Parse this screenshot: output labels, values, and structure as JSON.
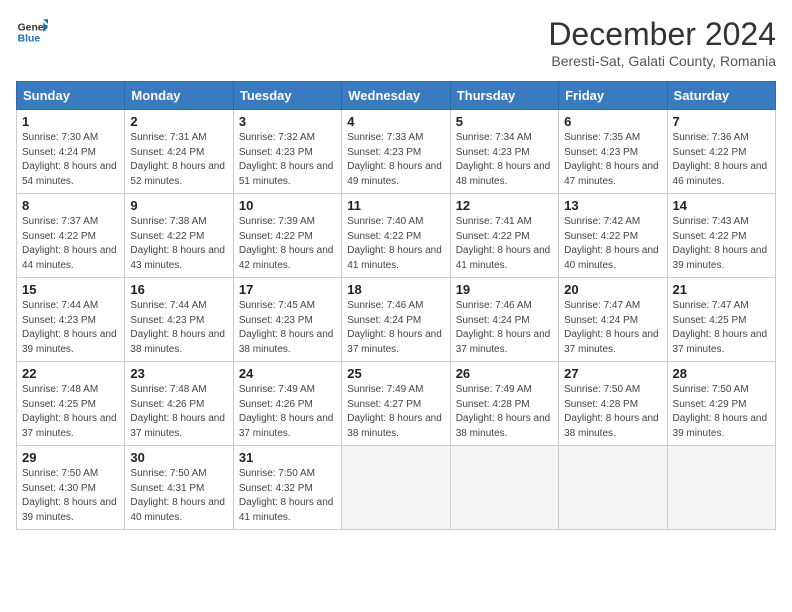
{
  "header": {
    "logo_line1": "General",
    "logo_line2": "Blue",
    "title": "December 2024",
    "subtitle": "Beresti-Sat, Galati County, Romania"
  },
  "weekdays": [
    "Sunday",
    "Monday",
    "Tuesday",
    "Wednesday",
    "Thursday",
    "Friday",
    "Saturday"
  ],
  "weeks": [
    [
      {
        "day": "1",
        "sunrise": "Sunrise: 7:30 AM",
        "sunset": "Sunset: 4:24 PM",
        "daylight": "Daylight: 8 hours and 54 minutes."
      },
      {
        "day": "2",
        "sunrise": "Sunrise: 7:31 AM",
        "sunset": "Sunset: 4:24 PM",
        "daylight": "Daylight: 8 hours and 52 minutes."
      },
      {
        "day": "3",
        "sunrise": "Sunrise: 7:32 AM",
        "sunset": "Sunset: 4:23 PM",
        "daylight": "Daylight: 8 hours and 51 minutes."
      },
      {
        "day": "4",
        "sunrise": "Sunrise: 7:33 AM",
        "sunset": "Sunset: 4:23 PM",
        "daylight": "Daylight: 8 hours and 49 minutes."
      },
      {
        "day": "5",
        "sunrise": "Sunrise: 7:34 AM",
        "sunset": "Sunset: 4:23 PM",
        "daylight": "Daylight: 8 hours and 48 minutes."
      },
      {
        "day": "6",
        "sunrise": "Sunrise: 7:35 AM",
        "sunset": "Sunset: 4:23 PM",
        "daylight": "Daylight: 8 hours and 47 minutes."
      },
      {
        "day": "7",
        "sunrise": "Sunrise: 7:36 AM",
        "sunset": "Sunset: 4:22 PM",
        "daylight": "Daylight: 8 hours and 46 minutes."
      }
    ],
    [
      {
        "day": "8",
        "sunrise": "Sunrise: 7:37 AM",
        "sunset": "Sunset: 4:22 PM",
        "daylight": "Daylight: 8 hours and 44 minutes."
      },
      {
        "day": "9",
        "sunrise": "Sunrise: 7:38 AM",
        "sunset": "Sunset: 4:22 PM",
        "daylight": "Daylight: 8 hours and 43 minutes."
      },
      {
        "day": "10",
        "sunrise": "Sunrise: 7:39 AM",
        "sunset": "Sunset: 4:22 PM",
        "daylight": "Daylight: 8 hours and 42 minutes."
      },
      {
        "day": "11",
        "sunrise": "Sunrise: 7:40 AM",
        "sunset": "Sunset: 4:22 PM",
        "daylight": "Daylight: 8 hours and 41 minutes."
      },
      {
        "day": "12",
        "sunrise": "Sunrise: 7:41 AM",
        "sunset": "Sunset: 4:22 PM",
        "daylight": "Daylight: 8 hours and 41 minutes."
      },
      {
        "day": "13",
        "sunrise": "Sunrise: 7:42 AM",
        "sunset": "Sunset: 4:22 PM",
        "daylight": "Daylight: 8 hours and 40 minutes."
      },
      {
        "day": "14",
        "sunrise": "Sunrise: 7:43 AM",
        "sunset": "Sunset: 4:22 PM",
        "daylight": "Daylight: 8 hours and 39 minutes."
      }
    ],
    [
      {
        "day": "15",
        "sunrise": "Sunrise: 7:44 AM",
        "sunset": "Sunset: 4:23 PM",
        "daylight": "Daylight: 8 hours and 39 minutes."
      },
      {
        "day": "16",
        "sunrise": "Sunrise: 7:44 AM",
        "sunset": "Sunset: 4:23 PM",
        "daylight": "Daylight: 8 hours and 38 minutes."
      },
      {
        "day": "17",
        "sunrise": "Sunrise: 7:45 AM",
        "sunset": "Sunset: 4:23 PM",
        "daylight": "Daylight: 8 hours and 38 minutes."
      },
      {
        "day": "18",
        "sunrise": "Sunrise: 7:46 AM",
        "sunset": "Sunset: 4:24 PM",
        "daylight": "Daylight: 8 hours and 37 minutes."
      },
      {
        "day": "19",
        "sunrise": "Sunrise: 7:46 AM",
        "sunset": "Sunset: 4:24 PM",
        "daylight": "Daylight: 8 hours and 37 minutes."
      },
      {
        "day": "20",
        "sunrise": "Sunrise: 7:47 AM",
        "sunset": "Sunset: 4:24 PM",
        "daylight": "Daylight: 8 hours and 37 minutes."
      },
      {
        "day": "21",
        "sunrise": "Sunrise: 7:47 AM",
        "sunset": "Sunset: 4:25 PM",
        "daylight": "Daylight: 8 hours and 37 minutes."
      }
    ],
    [
      {
        "day": "22",
        "sunrise": "Sunrise: 7:48 AM",
        "sunset": "Sunset: 4:25 PM",
        "daylight": "Daylight: 8 hours and 37 minutes."
      },
      {
        "day": "23",
        "sunrise": "Sunrise: 7:48 AM",
        "sunset": "Sunset: 4:26 PM",
        "daylight": "Daylight: 8 hours and 37 minutes."
      },
      {
        "day": "24",
        "sunrise": "Sunrise: 7:49 AM",
        "sunset": "Sunset: 4:26 PM",
        "daylight": "Daylight: 8 hours and 37 minutes."
      },
      {
        "day": "25",
        "sunrise": "Sunrise: 7:49 AM",
        "sunset": "Sunset: 4:27 PM",
        "daylight": "Daylight: 8 hours and 38 minutes."
      },
      {
        "day": "26",
        "sunrise": "Sunrise: 7:49 AM",
        "sunset": "Sunset: 4:28 PM",
        "daylight": "Daylight: 8 hours and 38 minutes."
      },
      {
        "day": "27",
        "sunrise": "Sunrise: 7:50 AM",
        "sunset": "Sunset: 4:28 PM",
        "daylight": "Daylight: 8 hours and 38 minutes."
      },
      {
        "day": "28",
        "sunrise": "Sunrise: 7:50 AM",
        "sunset": "Sunset: 4:29 PM",
        "daylight": "Daylight: 8 hours and 39 minutes."
      }
    ],
    [
      {
        "day": "29",
        "sunrise": "Sunrise: 7:50 AM",
        "sunset": "Sunset: 4:30 PM",
        "daylight": "Daylight: 8 hours and 39 minutes."
      },
      {
        "day": "30",
        "sunrise": "Sunrise: 7:50 AM",
        "sunset": "Sunset: 4:31 PM",
        "daylight": "Daylight: 8 hours and 40 minutes."
      },
      {
        "day": "31",
        "sunrise": "Sunrise: 7:50 AM",
        "sunset": "Sunset: 4:32 PM",
        "daylight": "Daylight: 8 hours and 41 minutes."
      },
      null,
      null,
      null,
      null
    ]
  ]
}
